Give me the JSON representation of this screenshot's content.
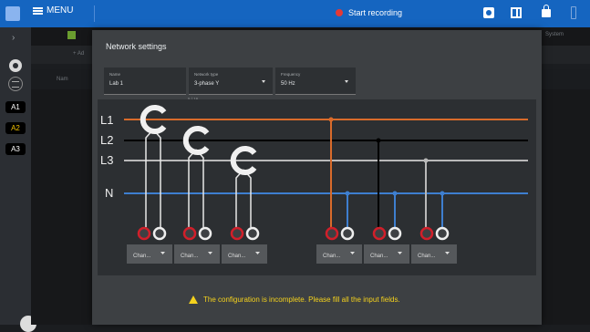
{
  "topbar": {
    "menu_label": "MENU",
    "record_label": "Start recording"
  },
  "sidebar": {
    "tags": [
      "A1",
      "A2",
      "A3"
    ]
  },
  "background": {
    "tab_right": "System",
    "row2": "+ Ad",
    "row3": "Nam"
  },
  "modal": {
    "title": "Network settings",
    "fields": [
      {
        "label": "Name",
        "value": "Lab 1"
      },
      {
        "label": "Network type",
        "value": "3-phase Y"
      },
      {
        "label": "Frequency",
        "value": "50 Hz"
      }
    ],
    "name_counter": "5 / 16",
    "lines": [
      "L1",
      "L2",
      "L3",
      "N"
    ],
    "channel_label": "Chan...",
    "warning": "The configuration is incomplete. Please fill all the input fields."
  },
  "colors": {
    "l1": "#d96b2b",
    "l2": "#000000",
    "l3": "#b9b9b9",
    "n": "#3e7fd0",
    "accent": "#1565c0",
    "warning": "#f5d21d"
  }
}
